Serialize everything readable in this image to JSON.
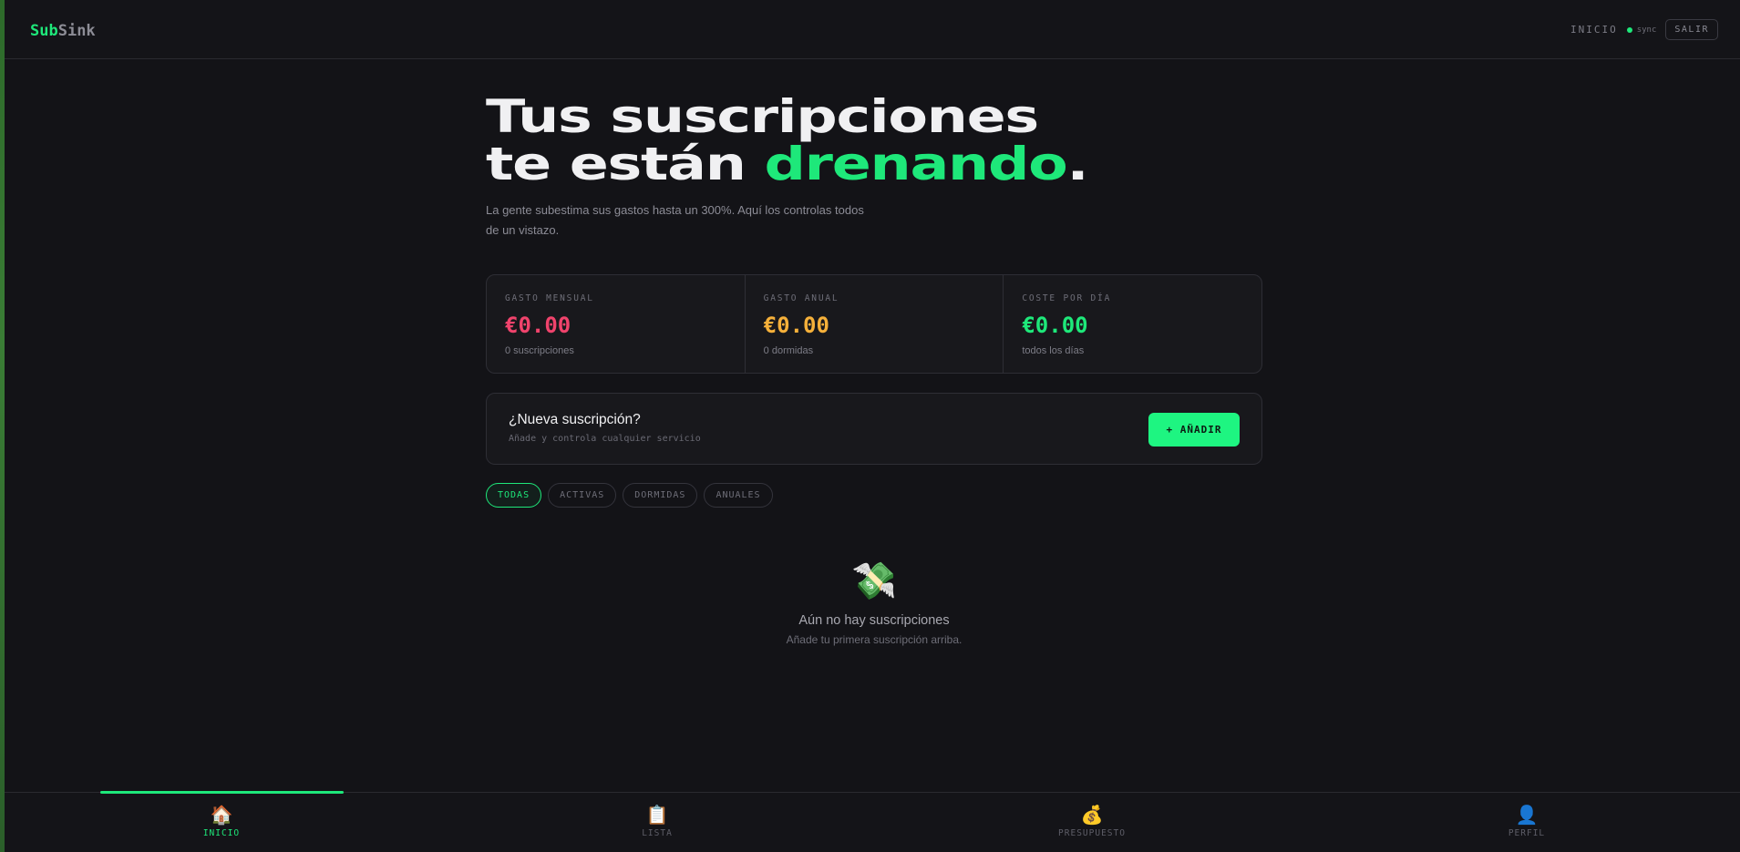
{
  "header": {
    "logo_part1": "Sub",
    "logo_part2": "Sink",
    "nav_inicio": "INICIO",
    "sync_label": "sync",
    "logout_label": "SALIR"
  },
  "hero": {
    "title_line1": "Tus suscripciones",
    "title_line2_prefix": "te están ",
    "title_line2_highlight": "drenando",
    "title_line2_suffix": ".",
    "subtitle": "La gente subestima sus gastos hasta un 300%. Aquí los controlas todos de un vistazo."
  },
  "stats": [
    {
      "label": "GASTO MENSUAL",
      "value": "€0.00",
      "note": "0 suscripciones",
      "color": "#f0436c"
    },
    {
      "label": "GASTO ANUAL",
      "value": "€0.00",
      "note": "0 dormidas",
      "color": "#f5b03a"
    },
    {
      "label": "COSTE POR DÍA",
      "value": "€0.00",
      "note": "todos los días",
      "color": "#1ee87a"
    }
  ],
  "new_subscription": {
    "title": "¿Nueva suscripción?",
    "subtitle": "Añade y controla cualquier servicio",
    "button_label": "+ AÑADIR"
  },
  "filters": [
    {
      "label": "TODAS",
      "active": true
    },
    {
      "label": "ACTIVAS",
      "active": false
    },
    {
      "label": "DORMIDAS",
      "active": false
    },
    {
      "label": "ANUALES",
      "active": false
    }
  ],
  "empty_state": {
    "icon": "money-with-wings-icon",
    "title": "Aún no hay suscripciones",
    "subtitle": "Añade tu primera suscripción arriba."
  },
  "bottom_nav": [
    {
      "label": "INICIO",
      "icon": "house-icon",
      "active": true
    },
    {
      "label": "LISTA",
      "icon": "clipboard-icon",
      "active": false
    },
    {
      "label": "PRESUPUESTO",
      "icon": "money-bag-icon",
      "active": false
    },
    {
      "label": "PERFIL",
      "icon": "user-icon",
      "active": false
    }
  ],
  "colors": {
    "accent": "#1ee87a",
    "background": "#131317",
    "monthly": "#f0436c",
    "annual": "#f5b03a",
    "daily": "#1ee87a"
  }
}
